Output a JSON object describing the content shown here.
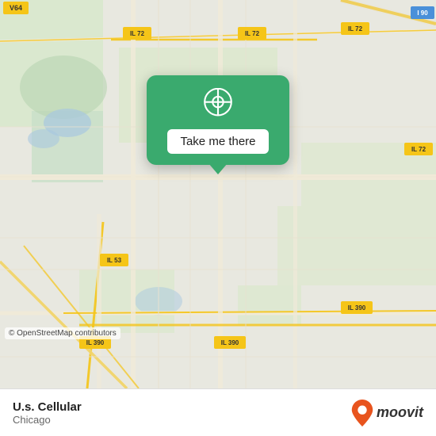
{
  "map": {
    "attribution": "© OpenStreetMap contributors",
    "background_color": "#e8e0d8"
  },
  "popup": {
    "button_label": "Take me there",
    "pin_color": "#ffffff"
  },
  "bottom_bar": {
    "location_name": "U.s. Cellular",
    "location_city": "Chicago",
    "moovit_text": "moovit"
  },
  "road_labels": [
    "IL 72",
    "IL 72",
    "IL 72",
    "IL 53",
    "IL 390",
    "IL 390",
    "IL 390",
    "V64",
    "I 90"
  ],
  "colors": {
    "map_green_card": "#3aaa6e",
    "road_yellow": "#f5c518",
    "map_bg": "#e8e0d8",
    "map_green_area": "#c8dfc8"
  }
}
